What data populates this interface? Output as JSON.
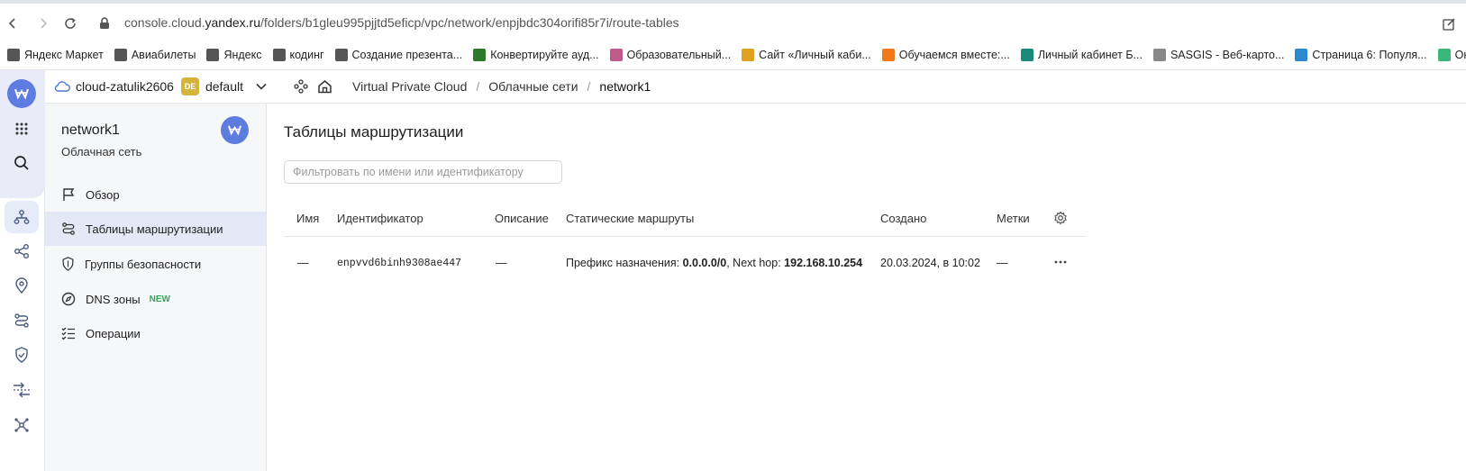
{
  "browser": {
    "url_prefix": "console.cloud.",
    "url_domain": "yandex.ru",
    "url_path": "/folders/b1gleu995pjjtd5eficp/vpc/network/enpjbdc304orifi85r7i/route-tables"
  },
  "bookmarks": [
    {
      "label": "Яндекс Маркет",
      "color": "#555555"
    },
    {
      "label": "Авиабилеты",
      "color": "#555555"
    },
    {
      "label": "Яндекс",
      "color": "#555555"
    },
    {
      "label": "кодинг",
      "color": "#555555"
    },
    {
      "label": "Создание презента...",
      "color": "#555555"
    },
    {
      "label": "Конвертируйте ауд...",
      "color": "#2a7a2a"
    },
    {
      "label": "Образовательный...",
      "color": "#c05a8a"
    },
    {
      "label": "Сайт «Личный каби...",
      "color": "#e0a020"
    },
    {
      "label": "Обучаемся вместе:...",
      "color": "#f07a1a"
    },
    {
      "label": "Личный кабинет Б...",
      "color": "#1a8a7a"
    },
    {
      "label": "SASGIS - Веб-карто...",
      "color": "#888888"
    },
    {
      "label": "Страница 6: Популя...",
      "color": "#2a8ad0"
    },
    {
      "label": "Онлайн озвучка тек...",
      "color": "#3ab87a"
    }
  ],
  "header": {
    "cloud_name": "cloud-zatulik2606",
    "folder_badge": "DE",
    "folder_name": "default",
    "breadcrumbs": [
      "Virtual Private Cloud",
      "Облачные сети",
      "network1"
    ]
  },
  "side": {
    "title": "network1",
    "subtitle": "Облачная сеть",
    "menu": [
      {
        "label": "Обзор"
      },
      {
        "label": "Таблицы маршрутизации"
      },
      {
        "label": "Группы безопасности"
      },
      {
        "label": "DNS зоны",
        "badge": "NEW"
      },
      {
        "label": "Операции"
      }
    ]
  },
  "main": {
    "title": "Таблицы маршрутизации",
    "filter_placeholder": "Фильтровать по имени или идентификатору",
    "columns": [
      "Имя",
      "Идентификатор",
      "Описание",
      "Статические маршруты",
      "Создано",
      "Метки"
    ],
    "rows": [
      {
        "name": "—",
        "id": "enpvvd6binh9308ae447",
        "description": "—",
        "route_prefix_label": "Префикс назначения: ",
        "route_prefix": "0.0.0.0/0",
        "route_hop_label": ", Next hop: ",
        "route_hop": "192.168.10.254",
        "created": "20.03.2024, в 10:02",
        "labels": "—"
      }
    ]
  },
  "colors": {
    "accent": "#5e7ce0",
    "active_bg": "#e4e8f7",
    "new_badge": "#3aa35b"
  }
}
